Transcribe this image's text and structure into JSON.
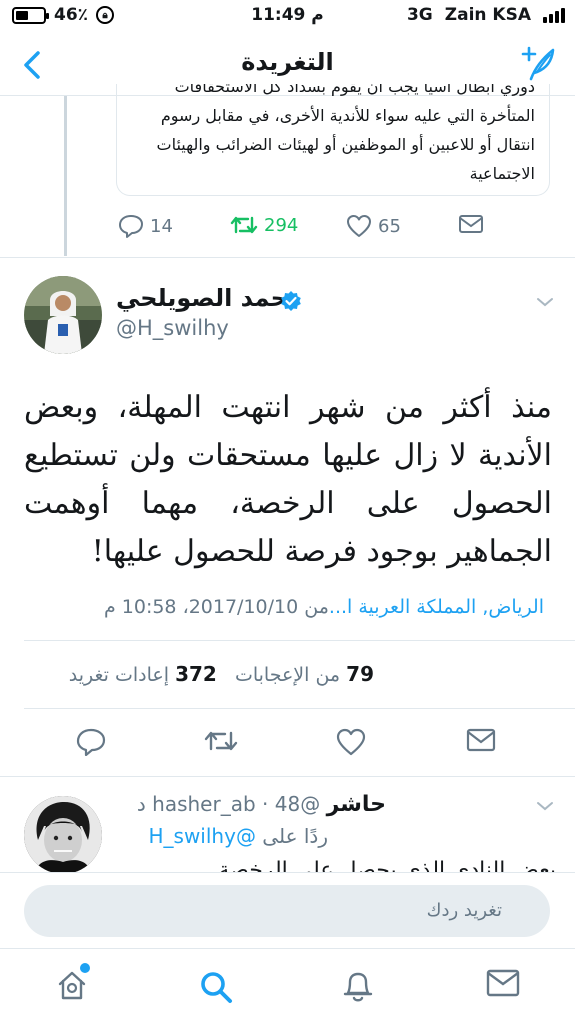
{
  "status_bar": {
    "battery_percent": "46٪",
    "time": "11:49 م",
    "network": "3G",
    "carrier": "Zain KSA"
  },
  "header": {
    "title": "التغريدة",
    "back_icon": "chevron-left-icon",
    "compose_icon": "compose-tweet-icon"
  },
  "quoted_tweet": {
    "lines": [
      "دوري أبطال آسيا يجب أن يقوم بسداد كل الاستحقاقات",
      "المتأخرة التي عليه سواء للأندية الأخرى، في مقابل رسوم",
      "انتقال أو للاعبين أو الموظفين أو لهيئات الضرائب والهيئات",
      "الاجتماعية"
    ],
    "replies": "14",
    "retweets": "294",
    "likes": "65"
  },
  "main_tweet": {
    "author_name": "حمد الصويلحي",
    "handle": "@H_swilhy",
    "verified": true,
    "text": "منذ أكثر من شهر انتهت المهلة، وبعض الأندية لا زال عليها مستحقات ولن تستطيع الحصول على الرخصة، مهما أوهمت الجماهير بوجود فرصة للحصول عليها!",
    "place": "الرياض, المملكة العربية ا...",
    "from_label": "من",
    "datetime": "2017/10/10، 10:58 م",
    "likes_count": "79",
    "likes_label": "من الإعجابات",
    "retweets_count": "372",
    "retweets_label": "إعادات تغريد"
  },
  "reply_tweet": {
    "author_name": "حاشر",
    "handle": "@hasher_ab",
    "time_ago": "48 د",
    "replying_label": "ردًا على",
    "replying_to": "@H_swilhy",
    "text_peek": "بعض النادي الذي يحصل على الرخصة"
  },
  "composer": {
    "placeholder": "تغريد ردك"
  },
  "tabbar": {
    "items": [
      "home-icon",
      "search-icon",
      "notifications-icon",
      "messages-icon"
    ],
    "active": "search-icon",
    "accent": "#1da1f2",
    "retweet_color": "#17bf63"
  }
}
